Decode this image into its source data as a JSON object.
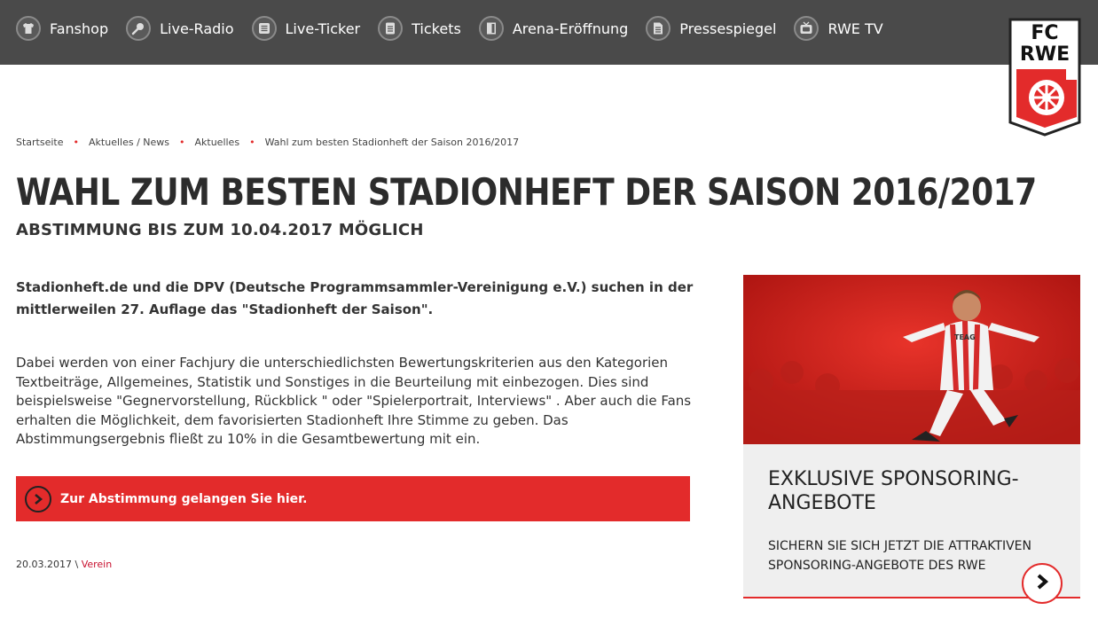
{
  "nav": {
    "items": [
      {
        "label": "Fanshop",
        "icon": "shirt-icon"
      },
      {
        "label": "Live-Radio",
        "icon": "microphone-icon"
      },
      {
        "label": "Live-Ticker",
        "icon": "ticker-icon"
      },
      {
        "label": "Tickets",
        "icon": "ticket-icon"
      },
      {
        "label": "Arena-Eröffnung",
        "icon": "door-icon"
      },
      {
        "label": "Pressespiegel",
        "icon": "document-icon"
      },
      {
        "label": "RWE TV",
        "icon": "tv-icon"
      }
    ]
  },
  "logo": {
    "line1": "FC",
    "line2": "RWE"
  },
  "breadcrumb": {
    "items": [
      "Startseite",
      "Aktuelles / News",
      "Aktuelles",
      "Wahl zum besten Stadionheft der Saison 2016/2017"
    ],
    "separator": "•"
  },
  "article": {
    "title": "WAHL ZUM BESTEN STADIONHEFT DER SAISON 2016/2017",
    "subtitle": "ABSTIMMUNG BIS ZUM 10.04.2017 MÖGLICH",
    "lead": "Stadionheft.de und die DPV (Deutsche Programmsammler-Vereinigung e.V.) suchen in der mittlerweilen 27. Auflage das \"Stadionheft der Saison\".",
    "body": "Dabei werden von einer Fachjury die unterschiedlichsten Bewertungskriterien aus den Kategorien Textbeiträge, Allgemeines, Statistik und Sonstiges in die Beurteilung mit einbezogen. Dies sind beispielsweise \"Gegnervorstellung, Rückblick \" oder \"Spielerportrait, Interviews\" . Aber auch die Fans erhalten die Möglichkeit, dem favorisierten Stadionheft Ihre Stimme zu geben. Das Abstimmungsergebnis fließt zu 10% in die Gesamtbewertung mit ein.",
    "cta_label": "Zur Abstimmung gelangen Sie hier.",
    "date": "20.03.2017",
    "meta_sep": " \\ ",
    "category": "Verein"
  },
  "teaser": {
    "title": "EXKLUSIVE SPONSORING-ANGEBOTE",
    "text": "SICHERN SIE SICH JETZT DIE ATTRAKTIVEN SPONSORING-ANGEBOTE DES RWE",
    "jersey_text": "TEAG"
  },
  "colors": {
    "accent": "#e32b2b",
    "topbar": "#4a4a4a",
    "teaser_bg": "#efefef"
  }
}
